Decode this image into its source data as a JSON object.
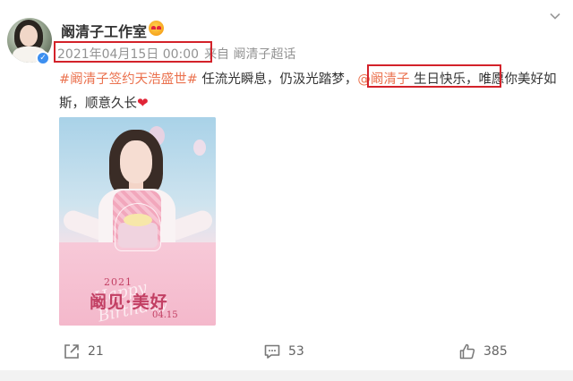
{
  "post": {
    "author": "阚清子工作室",
    "date": "2021年04月15日 00:00",
    "source": "来自 阚清子超话",
    "text": {
      "hashtag": "#阚清子签约天浩盛世#",
      "part1": " 任流光瞬息，仍汲光踏梦，",
      "mention": "@阚清子",
      "part2": " 生日快乐",
      "part3": "，唯愿你美好如斯，顺意久长",
      "emoji": "❤"
    },
    "image": {
      "year": "2021",
      "title": "阚见·美好",
      "date": "04.15",
      "script": "Happy Birthday"
    }
  },
  "actions": {
    "repost_count": "21",
    "comment_count": "53",
    "like_count": "385"
  },
  "icons": {
    "verified": "verified-icon",
    "vip": "vip-badge-icon",
    "more": "chevron-down-icon",
    "repost": "repost-icon",
    "comment": "comment-icon",
    "like": "thumbs-up-icon"
  },
  "colors": {
    "link": "#eb7350",
    "highlight_box": "#d3222a",
    "verified": "#3c8ff0"
  }
}
